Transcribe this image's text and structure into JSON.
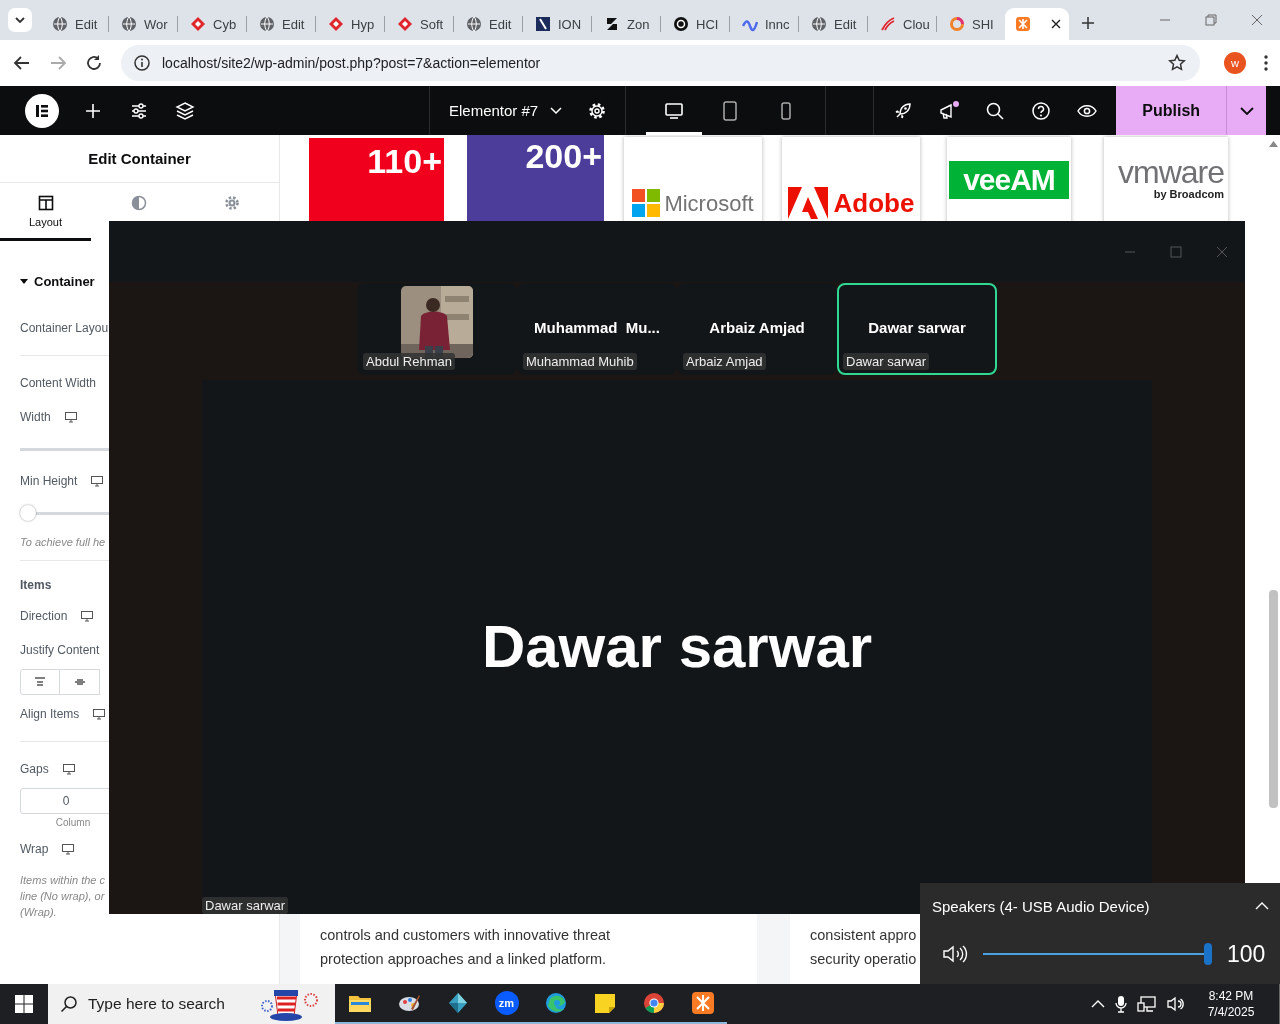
{
  "browser": {
    "tabs": [
      {
        "label": "Edit",
        "selected": false
      },
      {
        "label": "Wor",
        "selected": false
      },
      {
        "label": "Cyb",
        "selected": false
      },
      {
        "label": "Edit",
        "selected": false
      },
      {
        "label": "Hyp",
        "selected": false
      },
      {
        "label": "Soft",
        "selected": false
      },
      {
        "label": "Edit",
        "selected": false
      },
      {
        "label": "ION",
        "selected": false
      },
      {
        "label": "Zon",
        "selected": false
      },
      {
        "label": "HCI",
        "selected": false
      },
      {
        "label": "Innc",
        "selected": false
      },
      {
        "label": "Edit",
        "selected": false
      },
      {
        "label": "Clou",
        "selected": false
      },
      {
        "label": "SHI",
        "selected": false
      },
      {
        "selected": true
      }
    ],
    "address": "localhost/site2/wp-admin/post.php?post=7&action=elementor",
    "profile_initial": "w"
  },
  "editor_bar": {
    "document_title": "Elementor #7",
    "devices": [
      {
        "kind": "desktop",
        "selected": true
      },
      {
        "kind": "tablet",
        "selected": false
      },
      {
        "kind": "mobile",
        "selected": false
      }
    ],
    "notification_dot": true,
    "publish": "Publish"
  },
  "panel": {
    "title": "Edit Container",
    "tabs": [
      {
        "kind": "layout",
        "label": "Layout",
        "selected": true
      },
      {
        "kind": "style",
        "selected": false
      },
      {
        "kind": "advanced",
        "selected": false
      }
    ],
    "controls": [
      {
        "kind": "section",
        "label": "Container",
        "expanded": true
      },
      {
        "kind": "field",
        "label": "Container Layou"
      },
      {
        "kind": "field",
        "label": "Content Width",
        "divider": true
      },
      {
        "kind": "field",
        "label": "Width",
        "responsive": true
      },
      {
        "kind": "track"
      },
      {
        "kind": "field",
        "label": "Min Height",
        "responsive": true
      },
      {
        "kind": "slider",
        "level": 0
      },
      {
        "kind": "note",
        "lines": [
          "To achieve full he"
        ]
      },
      {
        "kind": "heading",
        "label": "Items",
        "divider": true
      },
      {
        "kind": "field",
        "label": "Direction",
        "responsive": true
      },
      {
        "kind": "field",
        "label": "Justify Content"
      },
      {
        "kind": "buttons"
      },
      {
        "kind": "field",
        "label": "Align Items",
        "responsive": true
      },
      {
        "kind": "field",
        "label": "Gaps",
        "responsive": true,
        "divider": true
      },
      {
        "kind": "number",
        "value": "0",
        "caption": "Column"
      },
      {
        "kind": "field",
        "label": "Wrap",
        "responsive": true
      },
      {
        "kind": "note",
        "lines": [
          "Items within the c",
          "line (No wrap), or",
          "(Wrap)."
        ]
      }
    ]
  },
  "canvas": {
    "stats": [
      {
        "value": "110+",
        "color": "#f0001c"
      },
      {
        "value": "200+",
        "color": "#4c3d9b"
      }
    ],
    "logos": [
      {
        "kind": "microsoft",
        "text": "Microsoft"
      },
      {
        "kind": "adobe",
        "text": "Adobe"
      },
      {
        "kind": "veeam",
        "text": "veeAM"
      },
      {
        "kind": "vmware",
        "text": "vmware",
        "subtext": "by Broadcom"
      }
    ],
    "cards": [
      {
        "lines": [
          "controls and customers with innovative threat",
          "protection approaches and a linked platform."
        ]
      },
      {
        "lines": [
          "consistent appro",
          "security operatio"
        ]
      }
    ]
  },
  "meeting": {
    "participants": [
      {
        "label": "Abdul Rehman",
        "selected": false
      },
      {
        "kind": "name",
        "display_name": "Muhammad  Mu...",
        "label": "Muhammad Muhib",
        "selected": false
      },
      {
        "kind": "name",
        "display_name": "Arbaiz Amjad",
        "label": "Arbaiz Amjad",
        "selected": false
      },
      {
        "kind": "name",
        "display_name": "Dawar sarwar",
        "label": "Dawar sarwar",
        "selected": true
      }
    ],
    "speaker": "Dawar sarwar",
    "speaker_label": "Dawar sarwar"
  },
  "volume": {
    "device": "Speakers (4- USB Audio Device)",
    "level": 1,
    "reading": "100"
  },
  "taskbar": {
    "search_placeholder": "Type here to search",
    "apps": [
      {
        "kind": "folder",
        "running": true
      },
      {
        "kind": "paint",
        "running": true
      },
      {
        "kind": "diamond",
        "running": true
      },
      {
        "kind": "zoom",
        "text": "zm",
        "running": true
      },
      {
        "kind": "edge",
        "running": true
      },
      {
        "kind": "notes",
        "running": true
      },
      {
        "kind": "chrome",
        "running": true
      },
      {
        "kind": "xampp",
        "running": true
      }
    ],
    "time": "8:42 PM",
    "date": "7/4/2025"
  }
}
